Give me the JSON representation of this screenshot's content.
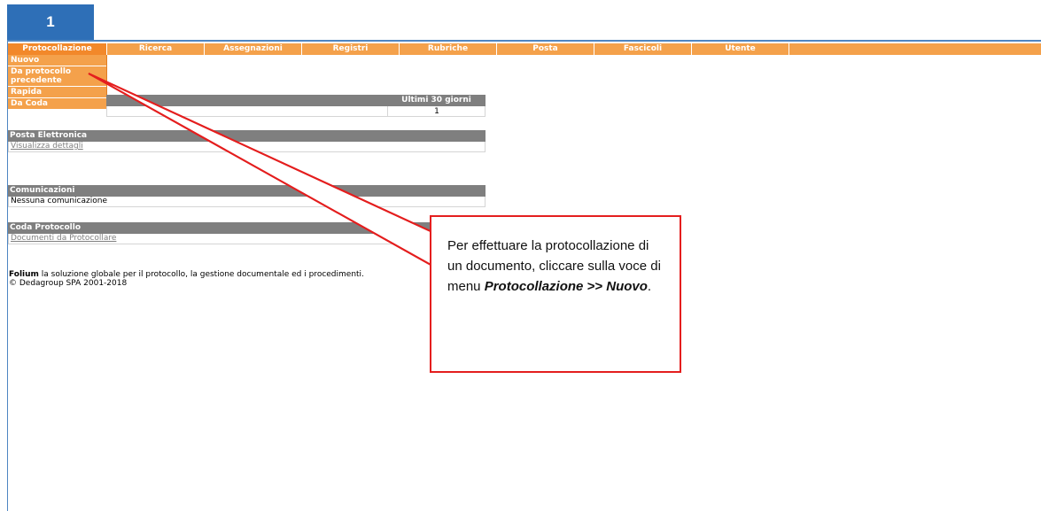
{
  "step_badge": "1",
  "menubar": {
    "items": [
      {
        "label": "Protocollazione",
        "active": true
      },
      {
        "label": "Ricerca"
      },
      {
        "label": "Assegnazioni"
      },
      {
        "label": "Registri"
      },
      {
        "label": "Rubriche"
      },
      {
        "label": "Posta"
      },
      {
        "label": "Fascicoli"
      },
      {
        "label": "Utente"
      }
    ]
  },
  "submenu": {
    "items": [
      "Nuovo",
      "Da protocollo precedente",
      "Rapida",
      "Da Coda"
    ]
  },
  "stats": {
    "column_header": "Ultimi 30 giorni",
    "value": "1"
  },
  "posta": {
    "title": "Posta Elettronica",
    "link": "Visualizza dettagli"
  },
  "comunicazioni": {
    "title": "Comunicazioni",
    "text": "Nessuna comunicazione"
  },
  "coda": {
    "title": "Coda Protocollo",
    "link": "Documenti da Protocollare"
  },
  "footer": {
    "brand": "Folium",
    "tagline": " la soluzione globale per il protocollo, la gestione documentale ed i procedimenti.",
    "copyright": "© Dedagroup SPA 2001-2018"
  },
  "callout": {
    "text_before": "Per effettuare la protocollazione di un documento, cliccare sulla voce di menu ",
    "emphasis": "Protocollazione >> Nuovo",
    "text_after": "."
  },
  "colors": {
    "menu_orange": "#f4a14b",
    "header_gray": "#7f7f7f",
    "badge_blue": "#2e6fb7",
    "callout_red": "#e41e1e"
  }
}
